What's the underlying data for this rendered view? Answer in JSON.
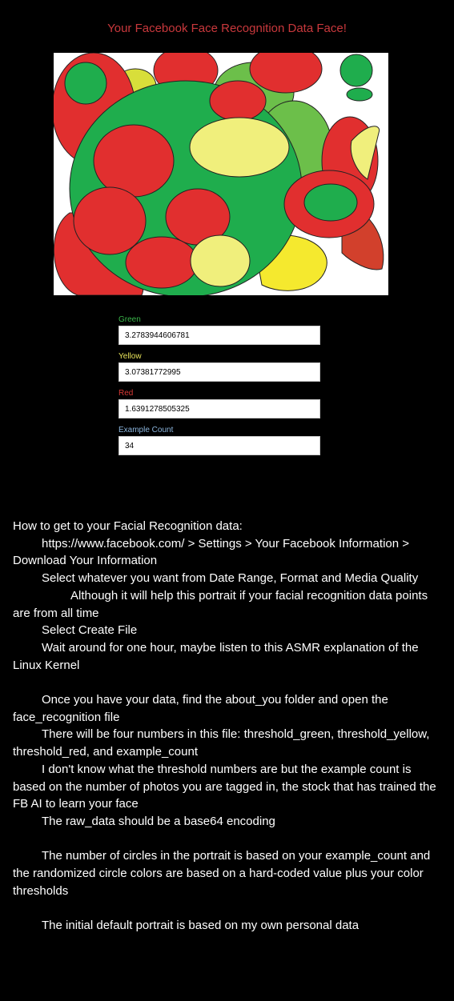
{
  "page": {
    "title": "Your Facebook Face Recognition Data Face!"
  },
  "colors": {
    "background": "#000000",
    "title": "#c8383c",
    "green": "#1fad4d",
    "light_green": "#6cbf4a",
    "yellow": "#f0ef7c",
    "bright_yellow": "#f5e92e",
    "red": "#e12f2f",
    "orange_red": "#d2402c",
    "label_green": "#3ab54a",
    "label_yellow": "#e8e35a",
    "label_red": "#d93a36",
    "label_blue": "#8bb4dc"
  },
  "fields": [
    {
      "label": "Green",
      "value": "3.2783944606781"
    },
    {
      "label": "Yellow",
      "value": "3.07381772995"
    },
    {
      "label": "Red",
      "value": "1.6391278505325"
    },
    {
      "label": "Example Count",
      "value": "34"
    }
  ],
  "instructions": [
    {
      "indent": 0,
      "text": "How to get to your Facial Recognition data:"
    },
    {
      "indent": 1,
      "text": "https://www.facebook.com/ > Settings > Your Facebook Information > Download Your Information"
    },
    {
      "indent": 1,
      "text": "Select whatever you want from Date Range, Format and Media Quality"
    },
    {
      "indent": 2,
      "text": "Although it will help this portrait if your facial recognition data points are from all time"
    },
    {
      "indent": 1,
      "text": "Select Create File"
    },
    {
      "indent": 1,
      "text": "Wait around for one hour, maybe listen to this ASMR explanation of the Linux Kernel"
    },
    {
      "indent": -1,
      "text": ""
    },
    {
      "indent": 1,
      "text": "Once you have your data, find the about_you folder and open the face_recognition file"
    },
    {
      "indent": 1,
      "text": "There will be four numbers in this file: threshold_green, threshold_yellow, threshold_red, and example_count"
    },
    {
      "indent": 1,
      "text": "I don't know what the threshold numbers are but the example count is based on the number of photos you are tagged in, the stock that has trained the FB AI to learn your face"
    },
    {
      "indent": 1,
      "text": "The raw_data should be a base64 encoding"
    },
    {
      "indent": -1,
      "text": ""
    },
    {
      "indent": 1,
      "text": "The number of circles in the portrait is based on your example_count and the randomized circle colors are based on a hard-coded value plus your color thresholds"
    },
    {
      "indent": -1,
      "text": ""
    },
    {
      "indent": 1,
      "text": "The initial default portrait is based on my own personal data"
    }
  ]
}
